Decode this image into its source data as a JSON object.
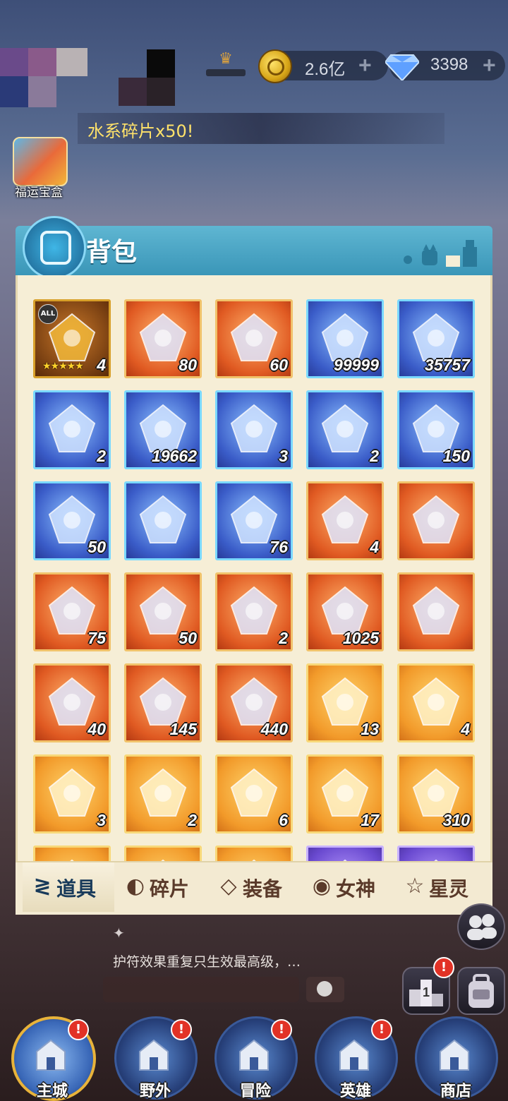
{
  "top_bar": {
    "gold": {
      "value": "2.6亿",
      "plus": "+"
    },
    "diamond": {
      "value": "3398",
      "plus": "+"
    }
  },
  "ticker": {
    "text": "水系碎片x50!"
  },
  "side": {
    "lucky_box_label": "福运宝盒"
  },
  "backpack": {
    "title": "背包",
    "items": [
      {
        "count": "4",
        "rarity": "gold",
        "icon": "hero-mask-icon",
        "all": "ALL",
        "stars": "★★★★★"
      },
      {
        "count": "80",
        "rarity": "red",
        "icon": "crystal-star-icon"
      },
      {
        "count": "60",
        "rarity": "red",
        "icon": "golden-chest-icon"
      },
      {
        "count": "99999",
        "rarity": "blue",
        "icon": "blue-crystal-icon"
      },
      {
        "count": "35757",
        "rarity": "blue",
        "icon": "blue-crystal-icon"
      },
      {
        "count": "2",
        "rarity": "blue",
        "icon": "fruit-icon"
      },
      {
        "count": "19662",
        "rarity": "blue",
        "icon": "berry-branch-icon"
      },
      {
        "count": "3",
        "rarity": "blue",
        "icon": "rune-stone-icon"
      },
      {
        "count": "2",
        "rarity": "blue",
        "icon": "hourglass-icon"
      },
      {
        "count": "150",
        "rarity": "blue",
        "icon": "dark-banner-icon"
      },
      {
        "count": "50",
        "rarity": "blue",
        "icon": "golden-armor-icon"
      },
      {
        "count": "",
        "rarity": "blue",
        "icon": "silver-scroll-icon"
      },
      {
        "count": "76",
        "rarity": "blue",
        "icon": "gold-scroll-icon"
      },
      {
        "count": "4",
        "rarity": "red",
        "icon": "card-frame-icon"
      },
      {
        "count": "",
        "rarity": "red",
        "icon": "orb-frame-icon"
      },
      {
        "count": "75",
        "rarity": "red",
        "icon": "orb-frame-icon"
      },
      {
        "count": "50",
        "rarity": "red",
        "icon": "ornate-chest-icon"
      },
      {
        "count": "2",
        "rarity": "red",
        "icon": "fire-orb-box-icon"
      },
      {
        "count": "1025",
        "rarity": "red",
        "icon": "dark-crystal-icon"
      },
      {
        "count": "",
        "rarity": "red",
        "icon": "blue-rune-crystal-icon"
      },
      {
        "count": "40",
        "rarity": "red",
        "icon": "star-shard-icon"
      },
      {
        "count": "145",
        "rarity": "red",
        "icon": "green-scroll-icon"
      },
      {
        "count": "440",
        "rarity": "red",
        "icon": "prism-gem-icon"
      },
      {
        "count": "13",
        "rarity": "orange",
        "icon": "card-frame-icon"
      },
      {
        "count": "4",
        "rarity": "orange",
        "icon": "blue-chest-icon"
      },
      {
        "count": "3",
        "rarity": "orange",
        "icon": "green-card-icon"
      },
      {
        "count": "2",
        "rarity": "orange",
        "icon": "golden-armor-icon"
      },
      {
        "count": "6",
        "rarity": "orange",
        "icon": "red-card-icon"
      },
      {
        "count": "17",
        "rarity": "orange",
        "icon": "crystal-shards-icon"
      },
      {
        "count": "310",
        "rarity": "orange",
        "icon": "purple-scroll-icon"
      },
      {
        "count": "",
        "rarity": "orange",
        "icon": "partial-item-icon"
      },
      {
        "count": "",
        "rarity": "orange",
        "icon": "partial-item-icon"
      },
      {
        "count": "",
        "rarity": "orange",
        "icon": "partial-item-icon"
      },
      {
        "count": "",
        "rarity": "purple",
        "icon": "partial-item-icon"
      },
      {
        "count": "",
        "rarity": "purple",
        "icon": "partial-item-icon"
      }
    ],
    "tabs": [
      {
        "label": "道具",
        "icon": "items-icon",
        "glyph": "≷",
        "active": true
      },
      {
        "label": "碎片",
        "icon": "fragment-icon",
        "glyph": "◐",
        "active": false
      },
      {
        "label": "装备",
        "icon": "equipment-icon",
        "glyph": "◇",
        "active": false
      },
      {
        "label": "女神",
        "icon": "goddess-icon",
        "glyph": "◉",
        "active": false
      },
      {
        "label": "星灵",
        "icon": "star-spirit-icon",
        "glyph": "☆",
        "active": false
      }
    ]
  },
  "chat": {
    "message": "护符效果重复只生效最高级，…"
  },
  "right_buttons": {
    "rank_badge": "!",
    "bag_badge": "!"
  },
  "bottom_nav": [
    {
      "label": "主城",
      "icon": "castle-icon",
      "badge": "!"
    },
    {
      "label": "野外",
      "icon": "wilderness-portal-icon",
      "badge": "!"
    },
    {
      "label": "冒险",
      "icon": "sword-icon",
      "badge": "!"
    },
    {
      "label": "英雄",
      "icon": "knight-helmet-icon",
      "badge": "!"
    },
    {
      "label": "商店",
      "icon": "shop-icon",
      "badge": ""
    }
  ],
  "colors": {
    "panel_header": "#3a96b8",
    "panel_body": "#f6eed6",
    "tab_text": "#5a3a2a",
    "active_tab_text": "#183a5a",
    "badge_red": "#e23226"
  }
}
